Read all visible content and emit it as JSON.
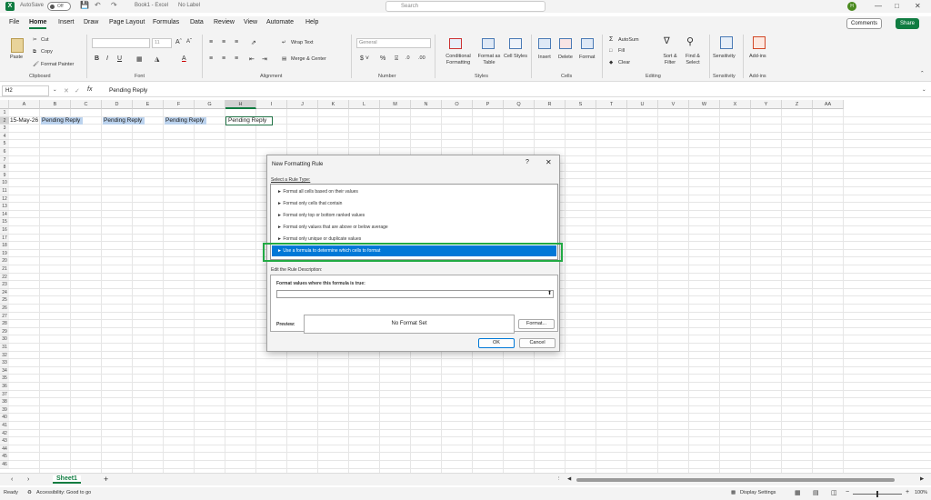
{
  "titlebar": {
    "autosave": "AutoSave",
    "autosave_state": "Off",
    "title": "Book1 - Excel",
    "label": "No Label",
    "search_placeholder": "Search",
    "avatar": "H"
  },
  "menu": {
    "tabs": [
      "File",
      "Home",
      "Insert",
      "Draw",
      "Page Layout",
      "Formulas",
      "Data",
      "Review",
      "View",
      "Automate",
      "Help"
    ],
    "active": "Home",
    "comments": "Comments",
    "share": "Share"
  },
  "ribbon": {
    "clipboard": {
      "paste": "Paste",
      "cut": "Cut",
      "copy": "Copy",
      "format_painter": "Format Painter",
      "label": "Clipboard"
    },
    "font": {
      "label": "Font",
      "size": "11"
    },
    "alignment": {
      "wrap": "Wrap Text",
      "merge": "Merge & Center",
      "label": "Alignment"
    },
    "number": {
      "format": "General",
      "label": "Number"
    },
    "styles": {
      "conditional": "Conditional Formatting",
      "format_table": "Format as Table",
      "cell_styles": "Cell Styles",
      "label": "Styles"
    },
    "cells": {
      "insert": "Insert",
      "delete": "Delete",
      "format": "Format",
      "label": "Cells"
    },
    "editing": {
      "autosum": "AutoSum",
      "fill": "Fill",
      "clear": "Clear",
      "sort": "Sort & Filter",
      "find": "Find & Select",
      "label": "Editing"
    },
    "sensitivity": {
      "button": "Sensitivity",
      "label": "Sensitivity"
    },
    "addins": {
      "button": "Add-ins",
      "label": "Add-ins"
    }
  },
  "formula_bar": {
    "name_box": "H2",
    "fx": "fx",
    "value": "Pending Reply"
  },
  "grid": {
    "columns": [
      "A",
      "B",
      "C",
      "D",
      "E",
      "F",
      "G",
      "H",
      "I",
      "J",
      "K",
      "L",
      "M",
      "N",
      "O",
      "P",
      "Q",
      "R",
      "S",
      "T",
      "U",
      "V",
      "W",
      "X",
      "Y",
      "Z",
      "AA"
    ],
    "rows": [
      "1",
      "2",
      "3",
      "4",
      "5",
      "6",
      "7",
      "8",
      "9",
      "10",
      "11",
      "12",
      "13",
      "14",
      "15",
      "16",
      "17",
      "18",
      "19",
      "20",
      "21",
      "22",
      "23",
      "24",
      "25",
      "26",
      "27",
      "28",
      "29",
      "30",
      "31",
      "32",
      "33",
      "34",
      "35",
      "36",
      "37",
      "38",
      "39",
      "40",
      "41",
      "42",
      "43",
      "44",
      "45",
      "46",
      "47"
    ],
    "cells": {
      "A2": "15-May-26",
      "B2": "Pending Reply",
      "D2": "Pending Reply",
      "F2": "Pending Reply",
      "H2": "Pending Reply"
    }
  },
  "sheets": {
    "active": "Sheet1"
  },
  "status": {
    "ready": "Ready",
    "accessibility": "Accessibility: Good to go",
    "display_settings": "Display Settings",
    "zoom": "100%"
  },
  "dialog": {
    "title": "New Formatting Rule",
    "help": "?",
    "select_type_label": "Select a Rule Type:",
    "rule_types": [
      "Format all cells based on their values",
      "Format only cells that contain",
      "Format only top or bottom ranked values",
      "Format only values that are above or below average",
      "Format only unique or duplicate values",
      "Use a formula to determine which cells to format"
    ],
    "selected_index": 5,
    "edit_desc_label": "Edit the Rule Description:",
    "formula_label": "Format values where this formula is true:",
    "formula_value": "",
    "preview_label": "Preview:",
    "preview_text": "No Format Set",
    "format_button": "Format...",
    "ok": "OK",
    "cancel": "Cancel"
  },
  "colors": {
    "accent": "#107c41",
    "selection": "#0078d7",
    "highlight_fill": "#bcd3ee",
    "annotation": "#22aa44"
  }
}
